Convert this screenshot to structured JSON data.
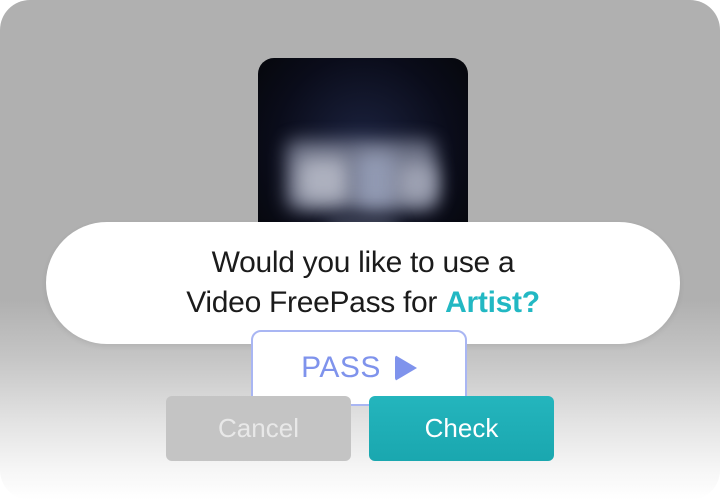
{
  "thumbnail": {
    "description_icon": "blurred-video-thumbnail"
  },
  "prompt": {
    "line1": "Would you like to use a",
    "line2_prefix": "Video FreePass for ",
    "line2_accent": "Artist?"
  },
  "pass_badge": {
    "label": "PASS",
    "icon": "play-icon"
  },
  "buttons": {
    "cancel_label": "Cancel",
    "check_label": "Check"
  },
  "colors": {
    "accent": "#22b8c3",
    "pass": "#7f93ec",
    "check_button": "#1aa7af",
    "cancel_button": "#c4c4c4"
  }
}
